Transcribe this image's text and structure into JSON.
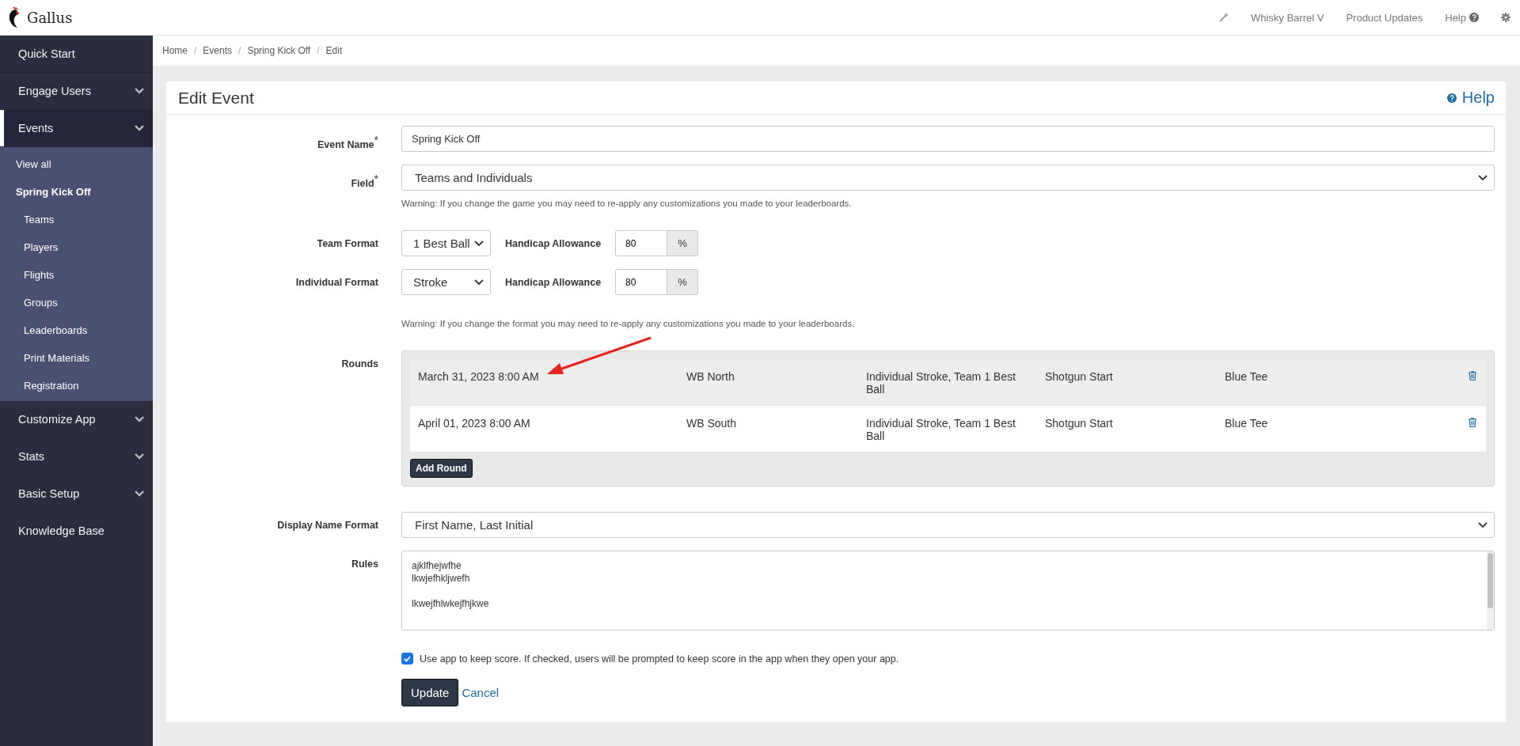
{
  "topbar": {
    "brand": "Gallus",
    "items": [
      {
        "kind": "account",
        "label": "Whisky Barrel V"
      },
      {
        "kind": "link",
        "label": "Product Updates"
      },
      {
        "kind": "help",
        "label": "Help"
      }
    ]
  },
  "sidebar": {
    "items": [
      {
        "label": "Quick Start",
        "kind": "link",
        "selected": false
      },
      {
        "label": "Engage Users",
        "kind": "group",
        "selected": false
      },
      {
        "label": "Events",
        "kind": "group",
        "expanded": true,
        "selected": true,
        "children": [
          {
            "label": "View all",
            "selected": false
          },
          {
            "label": "Spring Kick Off",
            "selected": true,
            "children": [
              {
                "label": "Teams"
              },
              {
                "label": "Players"
              },
              {
                "label": "Flights"
              },
              {
                "label": "Groups"
              },
              {
                "label": "Leaderboards"
              },
              {
                "label": "Print Materials"
              },
              {
                "label": "Registration"
              }
            ]
          }
        ]
      },
      {
        "label": "Customize App",
        "kind": "group",
        "selected": false
      },
      {
        "label": "Stats",
        "kind": "group",
        "selected": false
      },
      {
        "label": "Basic Setup",
        "kind": "group",
        "selected": false
      },
      {
        "label": "Knowledge Base",
        "kind": "link",
        "selected": false
      }
    ]
  },
  "breadcrumb": {
    "separator": "/",
    "items": [
      "Home",
      "Events",
      "Spring Kick Off",
      "Edit"
    ]
  },
  "card": {
    "title": "Edit Event",
    "help": "Help",
    "fields": [
      {
        "kind": "text",
        "label": "Event Name",
        "required_mark": "*",
        "value": "Spring Kick Off"
      },
      {
        "kind": "select",
        "label": "Field",
        "required_mark": "*",
        "value": "Teams and Individuals",
        "note": "Warning: If you change the game you may need to re-apply any customizations you made to your leaderboards."
      },
      {
        "kind": "format",
        "label": "Team Format",
        "value": "1 Best Ball",
        "allowance_label": "Handicap Allowance",
        "allowance": "80",
        "unit": "%"
      },
      {
        "kind": "format",
        "label": "Individual Format",
        "value": "Stroke",
        "allowance_label": "Handicap Allowance",
        "allowance": "80",
        "unit": "%",
        "note": "Warning: If you change the format you may need to re-apply any customizations you made to your leaderboards."
      },
      {
        "kind": "rounds",
        "label": "Rounds",
        "add_button": "Add Round",
        "rows": [
          {
            "highlighted": true,
            "cells": [
              "March 31, 2023 8:00 AM",
              "WB North",
              "Individual Stroke, Team 1 Best Ball",
              "Shotgun Start",
              "Blue Tee"
            ]
          },
          {
            "highlighted": false,
            "cells": [
              "April 01, 2023 8:00 AM",
              "WB South",
              "Individual Stroke, Team 1 Best Ball",
              "Shotgun Start",
              "Blue Tee"
            ]
          }
        ]
      },
      {
        "kind": "select",
        "label": "Display Name Format",
        "value": "First Name, Last Initial"
      },
      {
        "kind": "textarea",
        "label": "Rules",
        "value": "ajklfhejwfhe\nlkwjefhkljwefh\n\nlkwejfhlwkejfhjkwe"
      }
    ],
    "checkbox": {
      "label": "Use app to keep score. If checked, users will be prompted to keep score in the app when they open your app.",
      "checked": true
    },
    "submit": "Update",
    "cancel": "Cancel"
  }
}
